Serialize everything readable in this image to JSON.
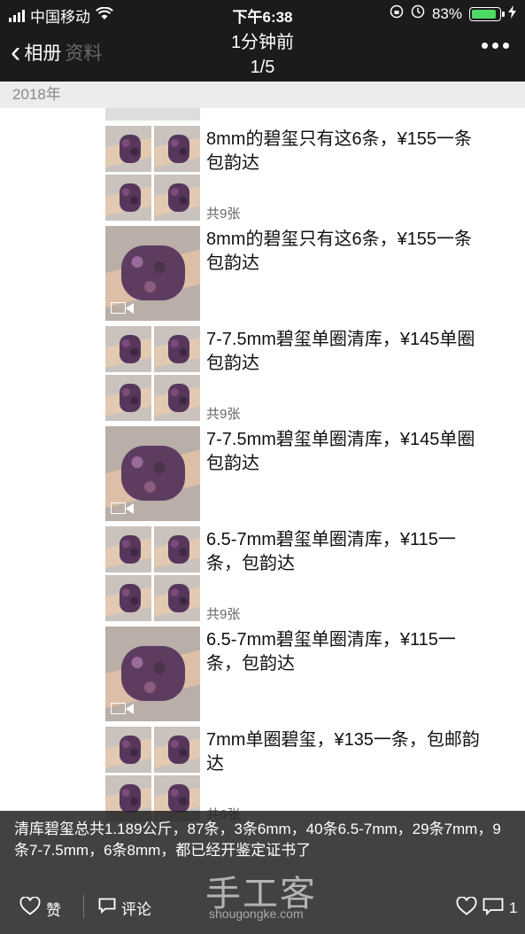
{
  "status_bar": {
    "carrier": "中国移动",
    "time": "下午6:38",
    "battery": "83%"
  },
  "nav": {
    "back_label": "相册",
    "ghost_left": "资料",
    "ghost_center": "相册",
    "title_time": "1分钟前",
    "title_index": "1/5"
  },
  "album": {
    "year": "2018年",
    "posts": [
      {
        "caption": "8mm的碧玺只有这6条，¥155一条包韵达",
        "count": "共9张",
        "media": "grid"
      },
      {
        "caption": "8mm的碧玺只有这6条，¥155一条包韵达",
        "media": "video"
      },
      {
        "caption": "7-7.5mm碧玺单圈清库，¥145单圈包韵达",
        "count": "共9张",
        "media": "grid"
      },
      {
        "caption": "7-7.5mm碧玺单圈清库，¥145单圈包韵达",
        "media": "video"
      },
      {
        "caption": "6.5-7mm碧玺单圈清库，¥115一条，包韵达",
        "count": "共9张",
        "media": "grid"
      },
      {
        "caption": "6.5-7mm碧玺单圈清库，¥115一条，包韵达",
        "media": "video"
      },
      {
        "caption": "7mm单圈碧玺，¥135一条，包邮韵达",
        "count": "共6张",
        "media": "grid"
      }
    ]
  },
  "overlay": {
    "caption": "清库碧玺总共1.189公斤，87条，3条6mm，40条6.5-7mm，29条7mm，9条7-7.5mm，6条8mm，都已经开鉴定证书了",
    "watermark": "手工客",
    "watermark_site": "shougongke.com",
    "like_label": "赞",
    "comment_label": "评论",
    "comment_count": "1"
  }
}
